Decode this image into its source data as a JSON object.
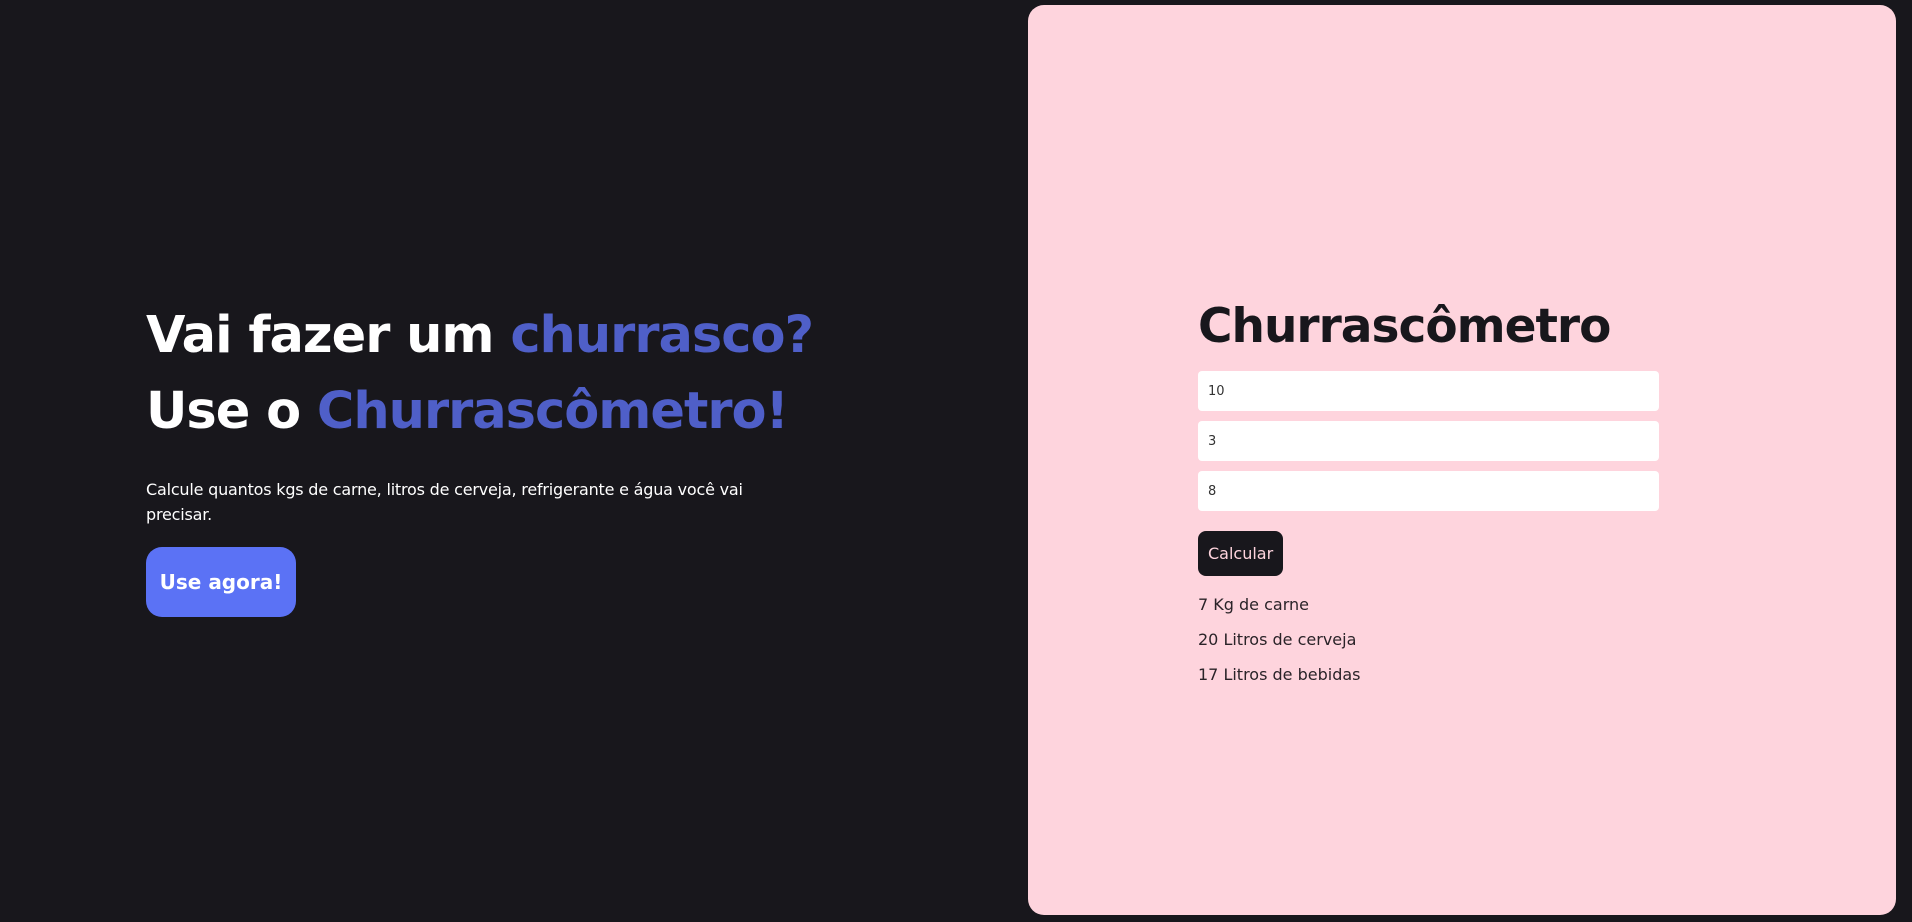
{
  "colors": {
    "page_background": "#18171c",
    "accent": "#4f5fc8",
    "cta_background": "#5b72f5",
    "panel_background": "#fed4dd",
    "dark": "#18171c"
  },
  "hero": {
    "line1_start": "Vai fazer um ",
    "line1_highlight": "churrasco?",
    "line2_start": "Use o ",
    "line2_highlight": "Churrascômetro!",
    "subtitle": "Calcule quantos kgs de carne, litros de cerveja, refrigerante e água você vai precisar.",
    "cta_label": "Use agora!"
  },
  "calculator": {
    "title": "Churrascômetro",
    "inputs": [
      {
        "value": "10"
      },
      {
        "value": "3"
      },
      {
        "value": "8"
      }
    ],
    "button_label": "Calcular",
    "results": [
      "7 Kg de carne",
      "20 Litros de cerveja",
      "17 Litros de bebidas"
    ]
  }
}
